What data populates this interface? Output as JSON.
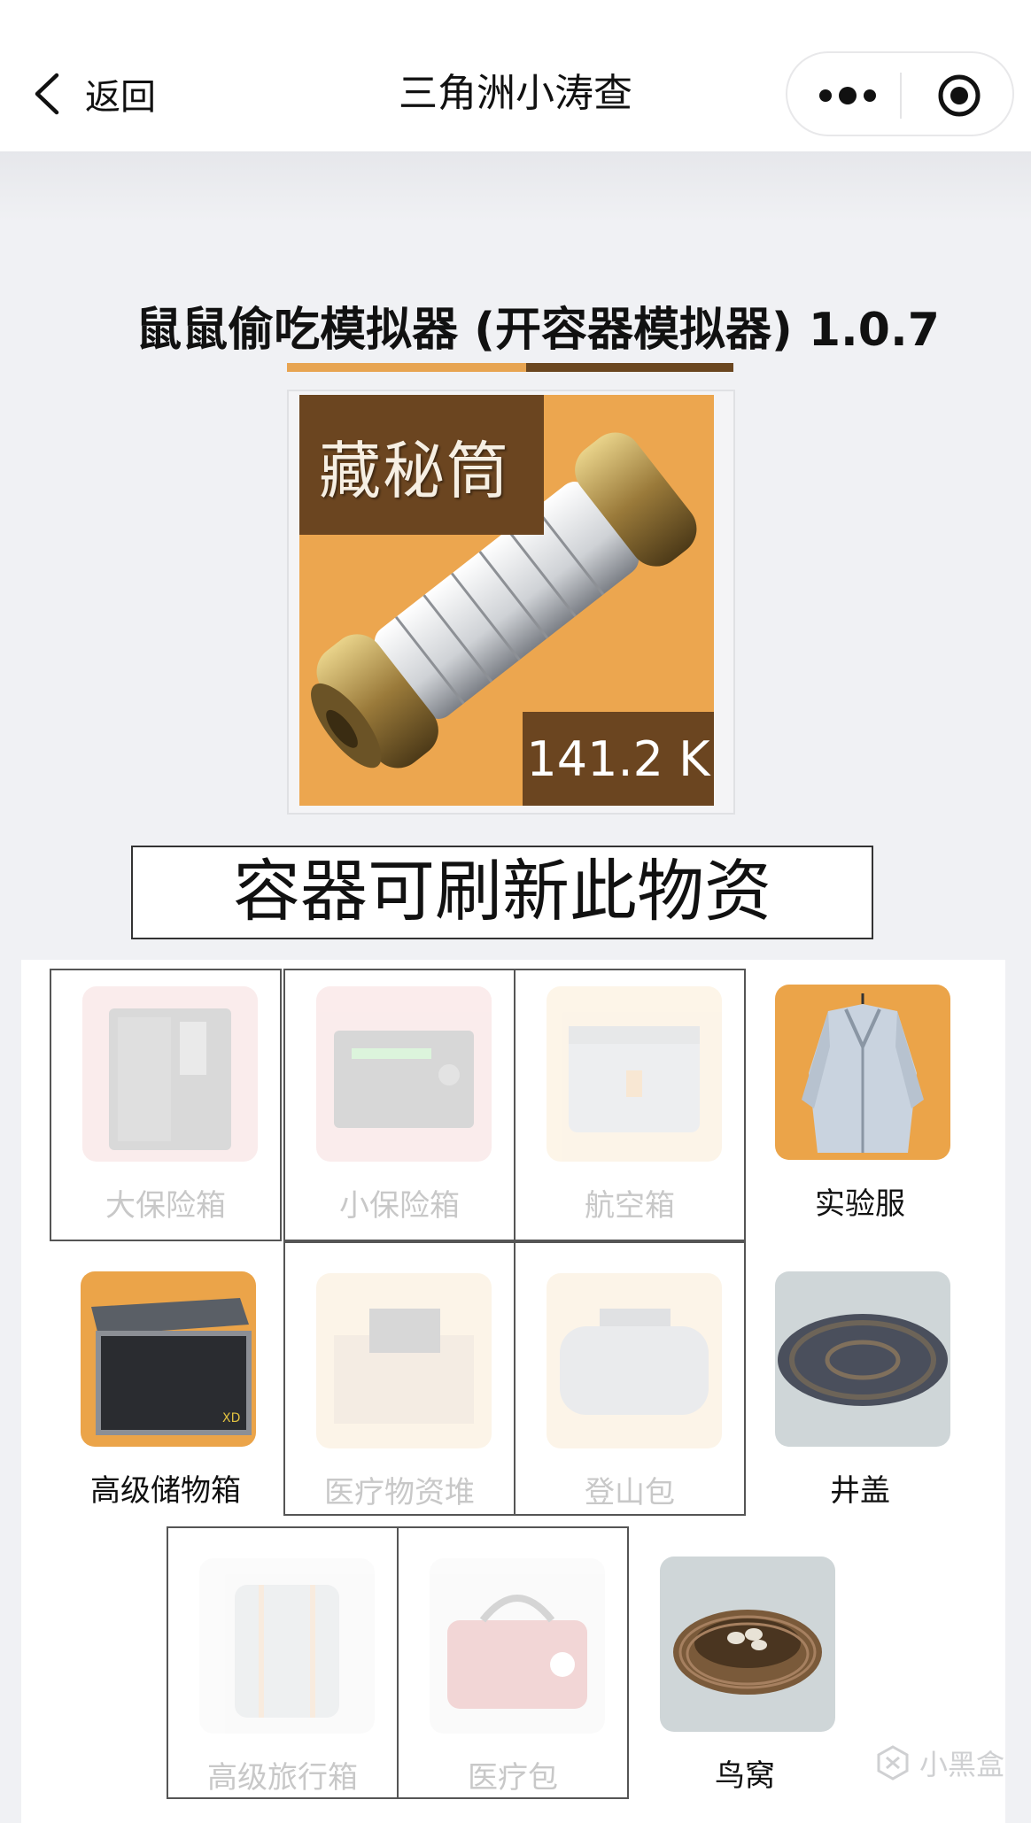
{
  "nav": {
    "back_label": "返回",
    "title": "三角洲小涛查"
  },
  "page": {
    "title": "鼠鼠偷吃模拟器 (开容器模拟器) 1.0.7"
  },
  "item": {
    "name": "藏秘筒",
    "value": "141.2 K",
    "card_color": "#eca64f",
    "label_color": "#6b4520"
  },
  "banner": {
    "text": "容器可刷新此物资"
  },
  "containers": [
    {
      "label": "大保险箱",
      "available": false,
      "icon": "large-safe-icon"
    },
    {
      "label": "小保险箱",
      "available": false,
      "icon": "small-safe-icon"
    },
    {
      "label": "航空箱",
      "available": false,
      "icon": "air-case-icon"
    },
    {
      "label": "实验服",
      "available": true,
      "icon": "lab-coat-icon"
    },
    {
      "label": "高级储物箱",
      "available": true,
      "icon": "storage-box-icon"
    },
    {
      "label": "医疗物资堆",
      "available": false,
      "icon": "medical-supply-pile-icon"
    },
    {
      "label": "登山包",
      "available": false,
      "icon": "hiking-bag-icon"
    },
    {
      "label": "井盖",
      "available": true,
      "icon": "manhole-cover-icon"
    },
    {
      "label": "高级旅行箱",
      "available": false,
      "icon": "suitcase-icon"
    },
    {
      "label": "医疗包",
      "available": false,
      "icon": "medical-bag-icon"
    },
    {
      "label": "鸟窝",
      "available": true,
      "icon": "bird-nest-icon"
    }
  ],
  "watermark": "小黑盒"
}
